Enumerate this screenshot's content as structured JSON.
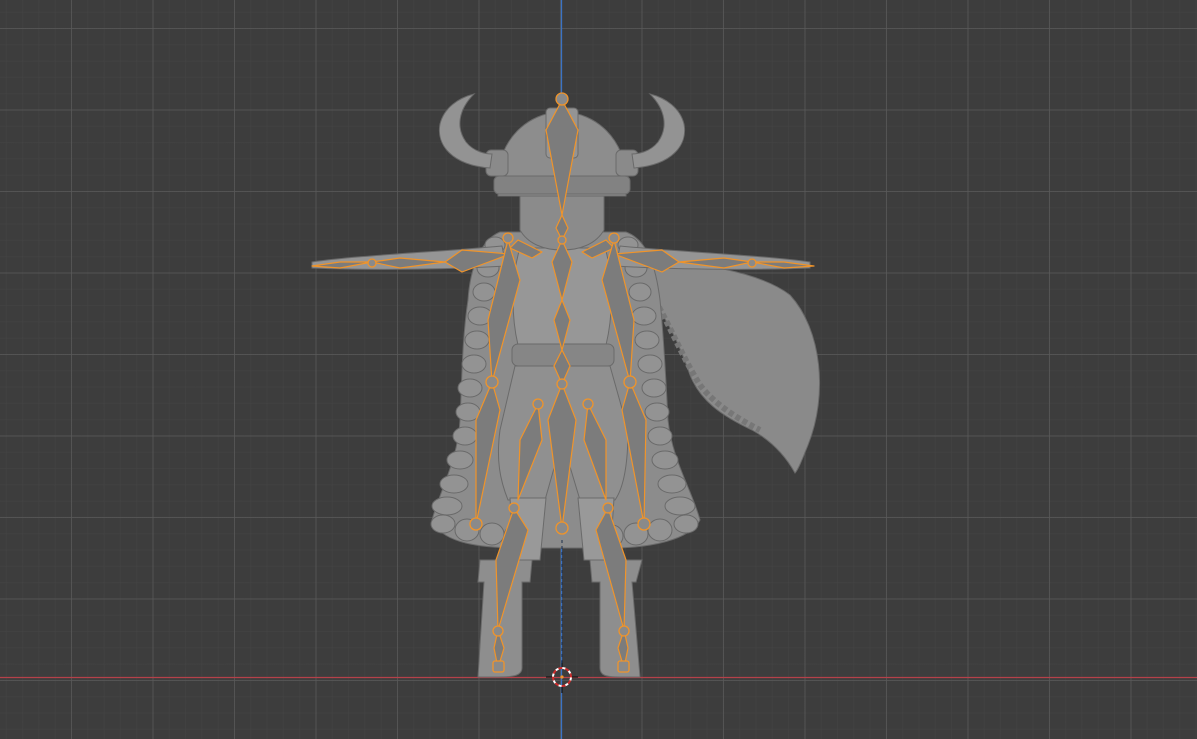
{
  "viewport": {
    "background": "#3d3d3d",
    "grid_major": "#5a5a5a",
    "grid_minor": "#464646",
    "axis_x_color": "#b5414a",
    "axis_z_color": "#3b73c4"
  },
  "model": {
    "mesh_color": "#8f8f8f",
    "mesh_shade": "#6e6e6e",
    "mesh_highlight": "#a9a9a9",
    "pose": "T-pose"
  },
  "armature": {
    "selected": true,
    "bone_color": "#7c7c7c",
    "outline_color": "#f0942a"
  },
  "cursor_3d": {
    "icon": "3d-cursor-icon",
    "ring_colors": [
      "#cc2b2b",
      "#ffffff"
    ]
  }
}
